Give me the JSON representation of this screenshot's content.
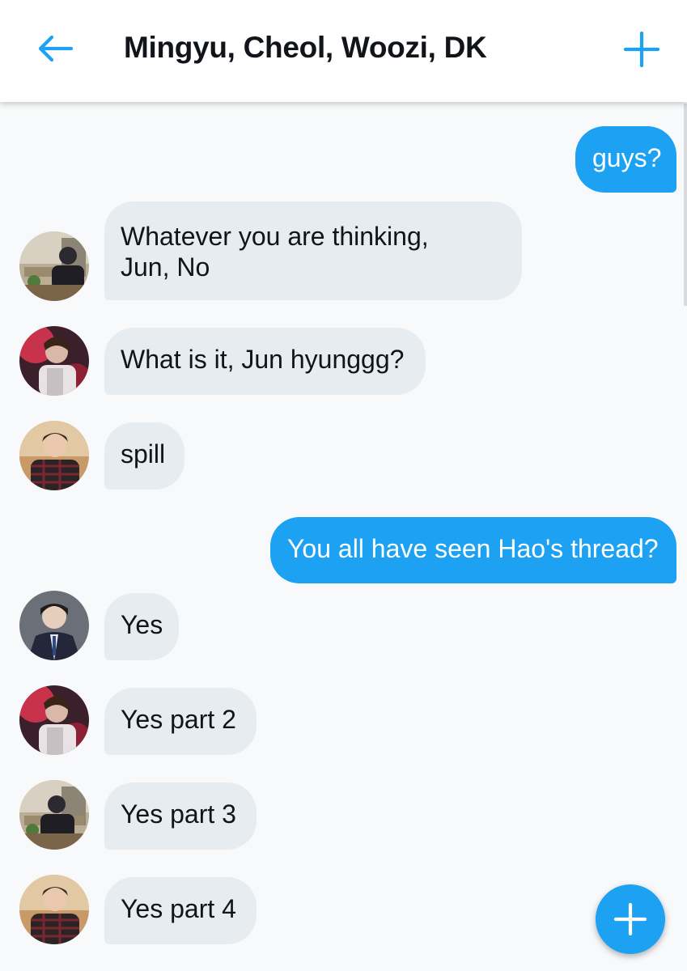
{
  "header": {
    "title": "Mingyu, Cheol, Woozi, DK",
    "back_icon": "arrow-left-icon",
    "add_icon": "plus-icon",
    "accent_color": "#1da1f2"
  },
  "messages": [
    {
      "direction": "outgoing",
      "text": "guys?"
    },
    {
      "direction": "incoming",
      "sender_avatar": "avatar-a",
      "lines": [
        "Whatever you are thinking,",
        "Jun, No"
      ]
    },
    {
      "direction": "incoming",
      "sender_avatar": "avatar-b",
      "text": "What is it, Jun hyunggg?"
    },
    {
      "direction": "incoming",
      "sender_avatar": "avatar-c",
      "text": "spill"
    },
    {
      "direction": "outgoing",
      "text": "You all have seen Hao's thread?"
    },
    {
      "direction": "incoming",
      "sender_avatar": "avatar-d",
      "text": "Yes"
    },
    {
      "direction": "incoming",
      "sender_avatar": "avatar-b",
      "text": "Yes part 2"
    },
    {
      "direction": "incoming",
      "sender_avatar": "avatar-a",
      "text": "Yes part 3"
    },
    {
      "direction": "incoming",
      "sender_avatar": "avatar-c",
      "text": "Yes part 4"
    }
  ],
  "fab": {
    "icon": "plus-icon"
  }
}
